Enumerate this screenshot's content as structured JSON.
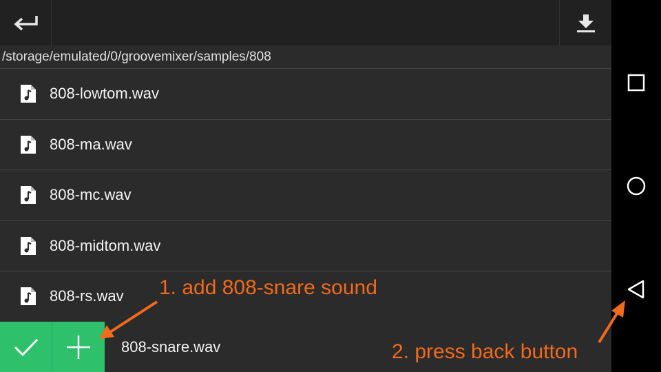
{
  "topbar": {
    "back_icon": "return-arrow-icon",
    "download_icon": "download-icon"
  },
  "path": "/storage/emulated/0/groovemixer/samples/808",
  "files": [
    {
      "name": "808-lowtom.wav",
      "icon": "audio-file-icon"
    },
    {
      "name": "808-ma.wav",
      "icon": "audio-file-icon"
    },
    {
      "name": "808-mc.wav",
      "icon": "audio-file-icon"
    },
    {
      "name": "808-midtom.wav",
      "icon": "audio-file-icon"
    },
    {
      "name": "808-rs.wav",
      "icon": "audio-file-icon"
    }
  ],
  "bottom": {
    "confirm_icon": "checkmark-icon",
    "add_icon": "plus-icon",
    "selected_file": "808-snare.wav"
  },
  "navbar": {
    "recents_icon": "square-icon",
    "home_icon": "circle-icon",
    "back_icon": "triangle-back-icon"
  },
  "annotations": {
    "step1": "1. add 808-snare sound",
    "step2": "2. press back button"
  },
  "colors": {
    "accent_green": "#2ec06b",
    "annotation_orange": "#f26a1b",
    "background": "#2b2b2b",
    "topbar": "#212121"
  }
}
